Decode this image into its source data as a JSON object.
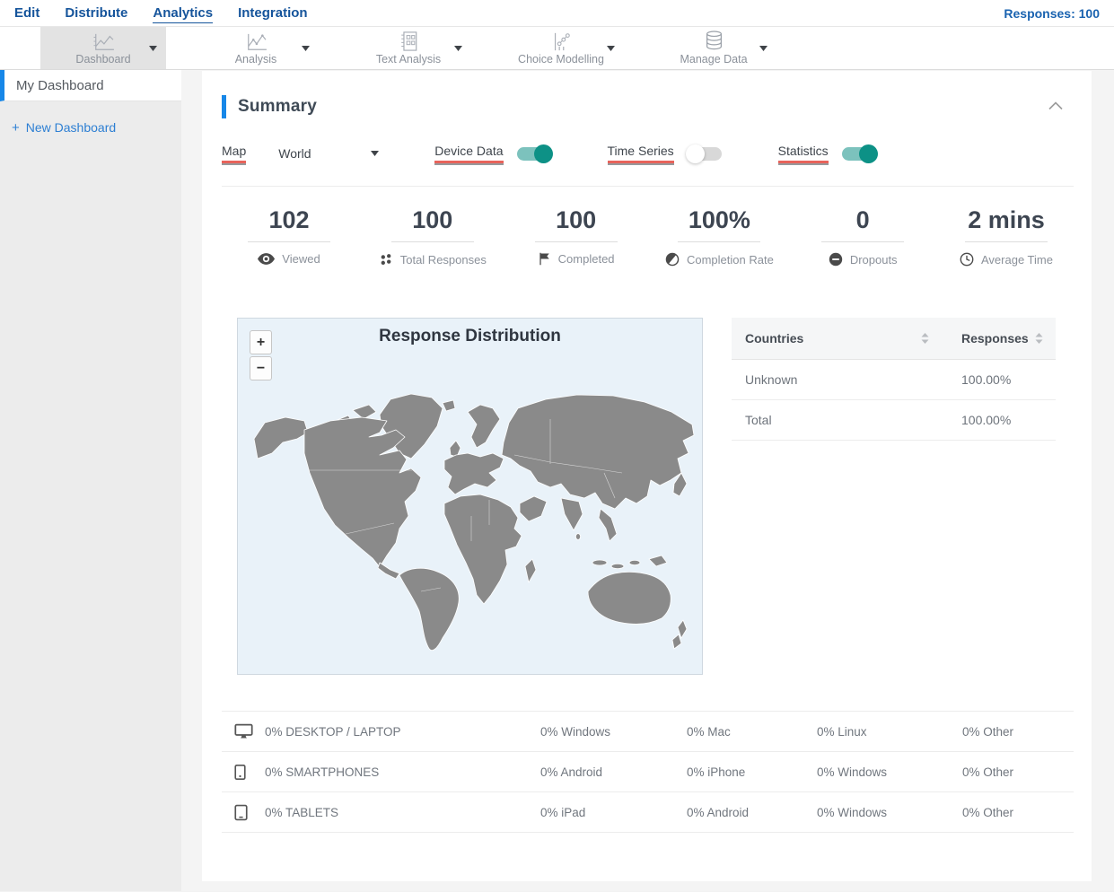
{
  "nav": {
    "items": [
      {
        "label": "Edit"
      },
      {
        "label": "Distribute"
      },
      {
        "label": "Analytics"
      },
      {
        "label": "Integration"
      }
    ],
    "responses_label": "Responses: 100"
  },
  "toolbar": {
    "items": [
      {
        "label": "Dashboard"
      },
      {
        "label": "Analysis"
      },
      {
        "label": "Text Analysis"
      },
      {
        "label": "Choice Modelling"
      },
      {
        "label": "Manage Data"
      }
    ]
  },
  "sidebar": {
    "my_dashboard_label": "My Dashboard",
    "new_dashboard_plus": "+",
    "new_dashboard_label": "New Dashboard"
  },
  "summary": {
    "title": "Summary",
    "controls": {
      "map_label": "Map",
      "map_select_value": "World",
      "toggles": [
        {
          "label": "Device Data",
          "state": "on"
        },
        {
          "label": "Time Series",
          "state": "off"
        },
        {
          "label": "Statistics",
          "state": "on"
        }
      ]
    },
    "stats": [
      {
        "value": "102",
        "label": "Viewed",
        "icon": "eye-icon"
      },
      {
        "value": "100",
        "label": "Total Responses",
        "icon": "dots-icon"
      },
      {
        "value": "100",
        "label": "Completed",
        "icon": "flag-icon"
      },
      {
        "value": "100%",
        "label": "Completion Rate",
        "icon": "half-circle-icon"
      },
      {
        "value": "0",
        "label": "Dropouts",
        "icon": "minus-circle-icon"
      },
      {
        "value": "2 mins",
        "label": "Average Time",
        "icon": "clock-icon"
      }
    ],
    "map": {
      "title": "Response Distribution",
      "zoom_in": "+",
      "zoom_out": "−"
    },
    "countries_table": {
      "columns": [
        "Countries",
        "Responses"
      ],
      "rows": [
        {
          "country": "Unknown",
          "responses": "100.00%"
        },
        {
          "country": "Total",
          "responses": "100.00%"
        }
      ]
    },
    "device_table": {
      "rows": [
        {
          "icon": "desktop-icon",
          "label": "0% DESKTOP / LAPTOP",
          "cols": [
            "0% Windows",
            "0% Mac",
            "0% Linux",
            "0% Other"
          ]
        },
        {
          "icon": "smartphone-icon",
          "label": "0% SMARTPHONES",
          "cols": [
            "0% Android",
            "0% iPhone",
            "0% Windows",
            "0% Other"
          ]
        },
        {
          "icon": "tablet-icon",
          "label": "0% TABLETS",
          "cols": [
            "0% iPad",
            "0% Android",
            "0% Windows",
            "0% Other"
          ]
        }
      ]
    }
  },
  "colors": {
    "nav_blue": "#15549b",
    "accent_blue": "#1787e8",
    "toggle_on_teal": "#0d9186",
    "underline_red": "#e8635b",
    "map_background": "#e9f2f9",
    "map_land": "#8a8a8a"
  }
}
